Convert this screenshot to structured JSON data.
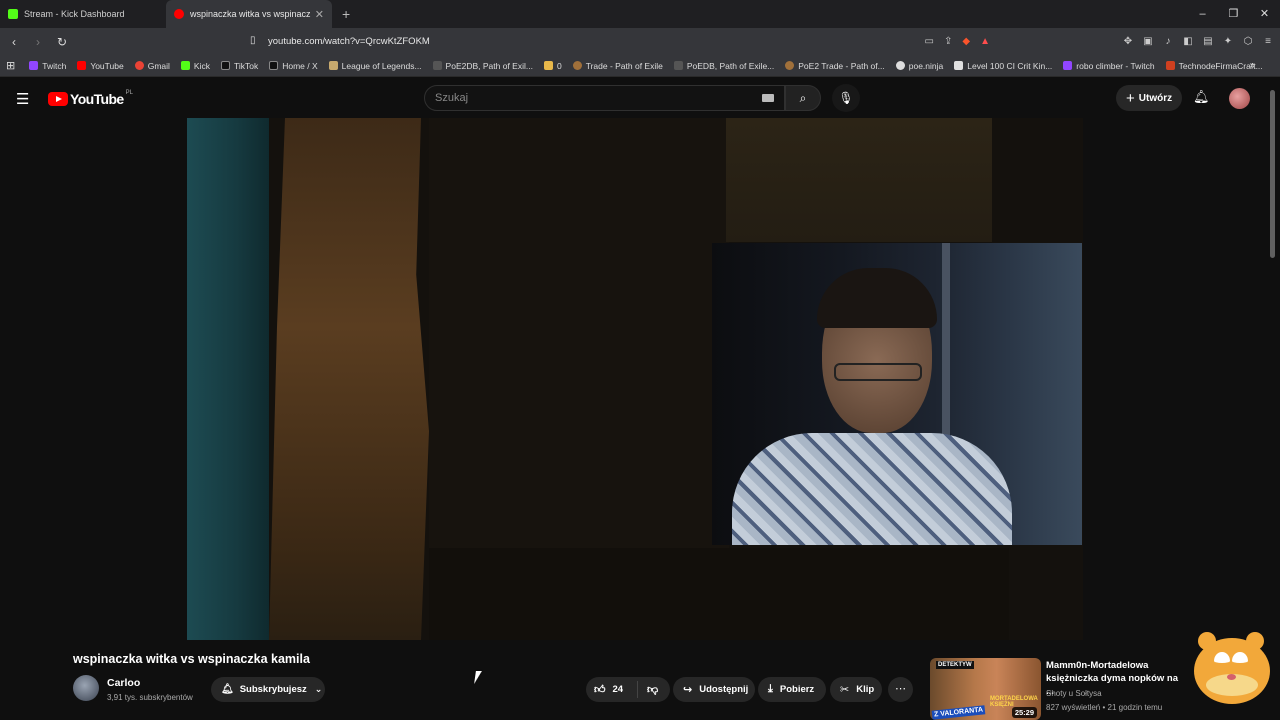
{
  "browser": {
    "tabs": [
      {
        "label": "Stream - Kick Dashboard",
        "color": "#53fc18",
        "active": false
      },
      {
        "label": "wspinaczka witka vs wspinacz",
        "color": "#ff0000",
        "active": true
      }
    ],
    "new_tab": "+",
    "url": "youtube.com/watch?v=QrcwKtZFOKM",
    "bookmarks": [
      {
        "label": "Twitch",
        "color": "#9146ff"
      },
      {
        "label": "YouTube",
        "color": "#ff0000"
      },
      {
        "label": "Gmail",
        "color": "#ea4335"
      },
      {
        "label": "Kick",
        "color": "#53fc18"
      },
      {
        "label": "TikTok",
        "color": "#000000"
      },
      {
        "label": "Home / X",
        "color": "#000000"
      },
      {
        "label": "League of Legends...",
        "color": "#c8aa6e"
      },
      {
        "label": "PoE2DB, Path of Exil...",
        "color": "#555555"
      },
      {
        "label": "0",
        "color": "#e8b84a"
      },
      {
        "label": "Trade - Path of Exile",
        "color": "#a0703a"
      },
      {
        "label": "PoEDB, Path of Exile...",
        "color": "#555555"
      },
      {
        "label": "PoE2 Trade - Path of...",
        "color": "#a0703a"
      },
      {
        "label": "poe.ninja",
        "color": "#dddddd"
      },
      {
        "label": "Level 100 CI Crit Kin...",
        "color": "#e0e0e0"
      },
      {
        "label": "robo climber - Twitch",
        "color": "#9146ff"
      },
      {
        "label": "TechnodeFirmaCraft...",
        "color": "#d04020"
      }
    ]
  },
  "youtube": {
    "logo_text": "YouTube",
    "country": "PL",
    "search_placeholder": "Szukaj",
    "create_label": "Utwórz"
  },
  "video": {
    "title": "wspinaczka witka vs wspinaczka kamila",
    "channel": "Carloo",
    "subscribers": "3,91 tys. subskrybentów",
    "subscribe_label": "Subskrybujesz",
    "likes": "24",
    "share_label": "Udostępnij",
    "download_label": "Pobierz",
    "clip_label": "Klip"
  },
  "recommendation": {
    "title": "Mamm0n-Mortadelowa księżniczka dyma nopków na ...",
    "channel": "Shoty u Sołtysa",
    "meta": "827 wyświetleń • 21 godzin temu",
    "duration": "25:29",
    "thumb_text_1": "DETEKTYW",
    "thumb_text_2": "Z VALORANTA",
    "thumb_text_3": "MORTADELOWA KSIĘŻNI"
  }
}
